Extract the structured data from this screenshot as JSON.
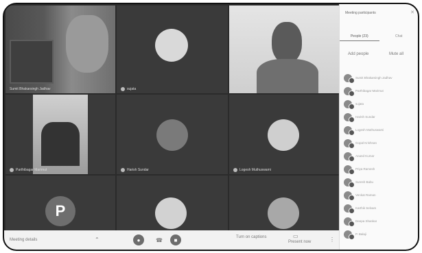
{
  "tiles": [
    {
      "name": "Sumit Bhakarsingh Jadhav"
    },
    {
      "name": "sujata"
    },
    {
      "name": ""
    },
    {
      "name": "Parthibagar Marimut"
    },
    {
      "name": "Harish Sundar"
    },
    {
      "name": "Logesh Muthuswami"
    },
    {
      "name": ""
    },
    {
      "name": ""
    },
    {
      "name": ""
    }
  ],
  "letter_avatar": "P",
  "bottom_bar": {
    "left_text": "Meeting details",
    "mic_icon": "mic-icon",
    "cam_icon": "camera-icon",
    "end_icon": "hangup-icon",
    "captions_label": "Turn on captions",
    "present_label": "Present now"
  },
  "panel": {
    "title": "Meeting participants",
    "tab_people": "People (23)",
    "tab_chat": "Chat",
    "action_add": "Add people",
    "action_add_sub": "",
    "action_mute": "Mute all",
    "action_mute_sub": "",
    "participants": [
      "Sumit Bhakarsingh Jadhav",
      "Parthibagar Marimut",
      "sujata",
      "Harish Sundar",
      "Logesh Muthuswami",
      "Gopal Krishnan",
      "Anand Kumar",
      "Priya Ramesh",
      "Suresh Babu",
      "Venkat Raman",
      "Karthik Selvam",
      "Deepa Shankar",
      "P. Balaji"
    ]
  },
  "colors": {
    "tile_bg": "#3a3a3a",
    "stage_bg": "#2b2b2b",
    "panel_bg": "#fafafa"
  }
}
